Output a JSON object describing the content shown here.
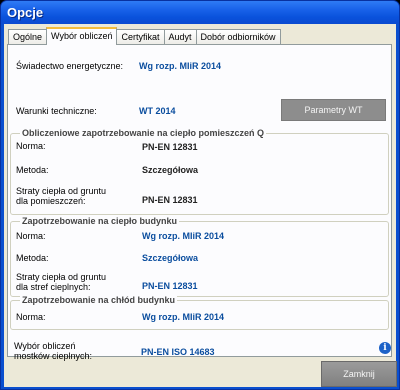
{
  "window": {
    "title": "Opcje"
  },
  "tabs": [
    {
      "label": "Ogólne"
    },
    {
      "label": "Wybór obliczeń"
    },
    {
      "label": "Certyfikat"
    },
    {
      "label": "Audyt"
    },
    {
      "label": "Dobór odbiorników"
    }
  ],
  "top": {
    "cert_label": "Świadectwo energetyczne:",
    "cert_value": "Wg rozp. MIiR 2014",
    "wt_label": "Warunki techniczne:",
    "wt_value": "WT 2014",
    "wt_button": "Parametry WT"
  },
  "groups": {
    "heat_rooms": {
      "title": "Obliczeniowe zapotrzebowanie na ciepło pomieszczeń Q",
      "norm_label": "Norma:",
      "norm_value": "PN-EN 12831",
      "method_label": "Metoda:",
      "method_value": "Szczegółowa",
      "ground_label_1": "Straty ciepła od gruntu",
      "ground_label_2": "dla pomieszczeń:",
      "ground_value": "PN-EN 12831"
    },
    "heat_building": {
      "title": "Zapotrzebowanie na ciepło budynku",
      "norm_label": "Norma:",
      "norm_value": "Wg rozp. MIiR 2014",
      "method_label": "Metoda:",
      "method_value": "Szczegółowa",
      "ground_label_1": "Straty ciepła od gruntu",
      "ground_label_2": "dla stref cieplnych:",
      "ground_value": "PN-EN 12831"
    },
    "cool_building": {
      "title": "Zapotrzebowanie na chłód budynku",
      "norm_label": "Norma:",
      "norm_value": "Wg rozp. MIiR 2014"
    }
  },
  "bridges": {
    "label_1": "Wybór obliczeń",
    "label_2": "mostków cieplnych:",
    "value": "PN-EN ISO 14683",
    "info_glyph": "i"
  },
  "footer": {
    "close_button": "Zamknij"
  }
}
